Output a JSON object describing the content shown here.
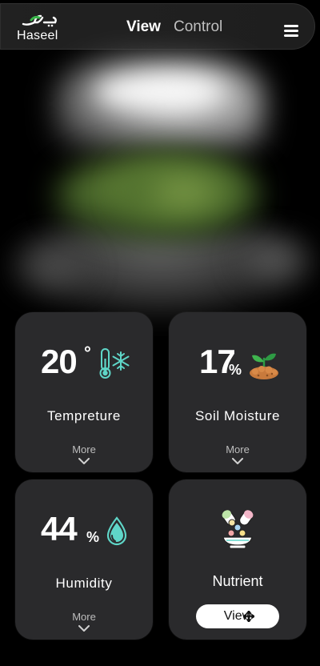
{
  "app": {
    "logo_arabic": "حصيل",
    "logo_latin": "Haseel"
  },
  "nav": {
    "view_label": "View",
    "control_label": "Control",
    "menu_icon": "hamburger-menu-icon"
  },
  "cards": {
    "temperature": {
      "value": "20",
      "unit": "°",
      "label": "Tempreture",
      "more_label": "More",
      "icon": "thermometer-snowflake-icon",
      "icon_color": "#5fd6c8"
    },
    "soil_moisture": {
      "value": "17",
      "unit": "%",
      "label": "Soil Moisture",
      "more_label": "More",
      "icon": "sprout-soil-icon"
    },
    "humidity": {
      "value": "44",
      "unit": "%",
      "label": "Humidity",
      "more_label": "More",
      "icon": "water-drop-icon",
      "icon_color": "#5fd6c8"
    },
    "nutrient": {
      "label": "Nutrient",
      "button_label": "View",
      "icon": "nutrient-capsules-icon"
    }
  },
  "colors": {
    "background": "#000000",
    "card": "#2a2a2c",
    "accent": "#5fd6c8",
    "muted_text": "#bdbdbd"
  }
}
